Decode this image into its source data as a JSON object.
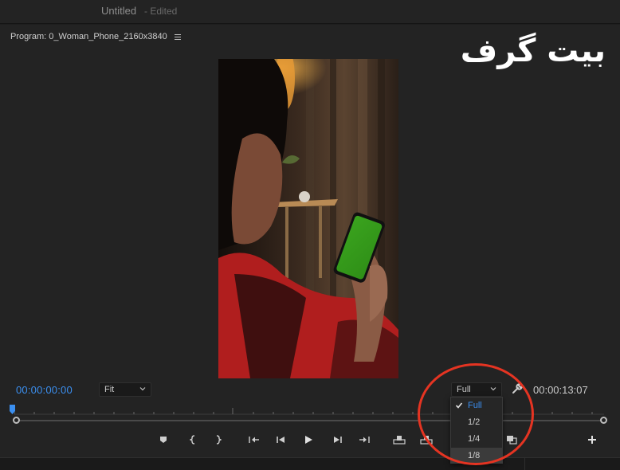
{
  "titlebar": {
    "title": "Untitled",
    "edited": "- Edited"
  },
  "program_panel": {
    "title": "Program: 0_Woman_Phone_2160x3840",
    "menu_icon": "hamburger-icon",
    "timecode_in": "00:00:00:00",
    "fit_select": {
      "value": "Fit"
    },
    "resolution_select": {
      "value": "Full",
      "options": [
        "Full",
        "1/2",
        "1/4",
        "1/8"
      ],
      "selected": "Full",
      "hovered": "1/8"
    },
    "timecode_out": "00:00:13:07",
    "settings_icon": "wrench-icon",
    "add_icon": "plus-icon"
  },
  "transport": {
    "icons": [
      "marker-icon",
      "mark-in-icon",
      "mark-out-icon",
      "go-to-in-icon",
      "step-back-icon",
      "play-icon",
      "step-forward-icon",
      "go-to-out-icon",
      "lift-icon",
      "extract-icon",
      "export-frame-icon",
      "compare-icon",
      "plus-icon"
    ]
  },
  "watermark": {
    "text": "بیت گرف"
  },
  "colors": {
    "accent": "#3b8ff0",
    "highlight_circle": "#e53422",
    "panel_bg": "#232323"
  }
}
